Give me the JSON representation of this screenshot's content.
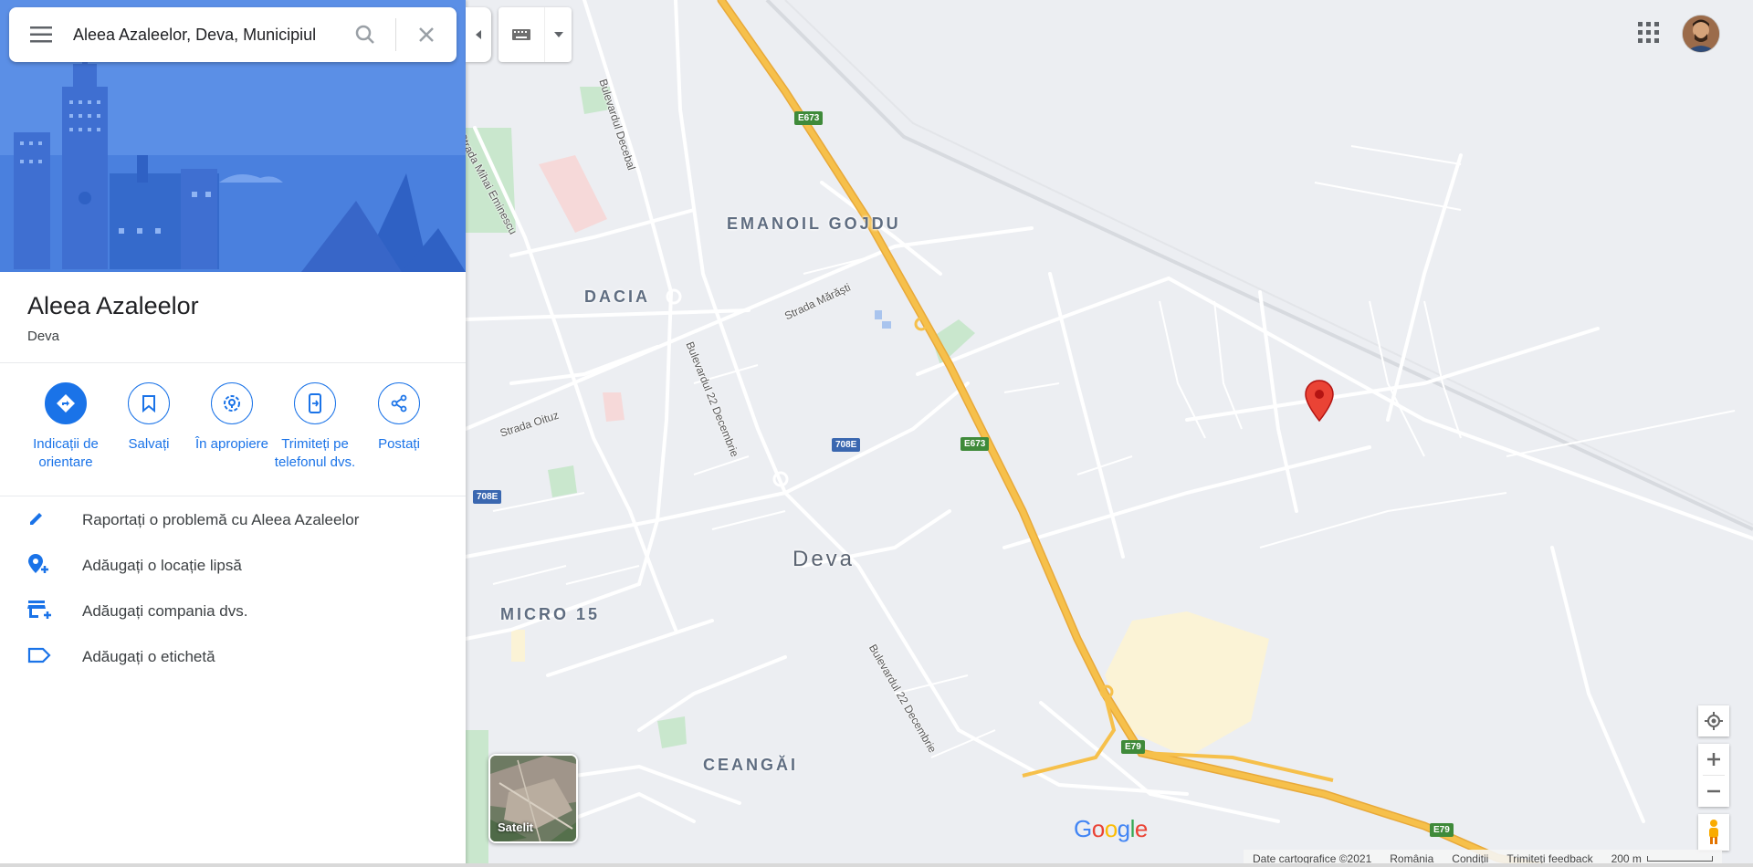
{
  "search": {
    "query": "Aleea Azaleelor, Deva, Municipiul"
  },
  "place": {
    "title": "Aleea Azaleelor",
    "subtitle": "Deva"
  },
  "actions": [
    {
      "label": "Indicații de orientare",
      "icon": "directions-icon"
    },
    {
      "label": "Salvați",
      "icon": "bookmark-icon"
    },
    {
      "label": "În apropiere",
      "icon": "nearby-icon"
    },
    {
      "label": "Trimiteți pe telefonul dvs.",
      "icon": "send-to-phone-icon"
    },
    {
      "label": "Postați",
      "icon": "share-icon"
    }
  ],
  "links": [
    {
      "label": "Raportați o problemă cu Aleea Azaleelor",
      "icon": "pencil-icon"
    },
    {
      "label": "Adăugați o locație lipsă",
      "icon": "add-location-icon"
    },
    {
      "label": "Adăugați compania dvs.",
      "icon": "add-business-icon"
    },
    {
      "label": "Adăugați o etichetă",
      "icon": "label-icon"
    }
  ],
  "map": {
    "neighborhoods": [
      "EMANOIL GOJDU",
      "DACIA",
      "MICRO 15",
      "CEANGĂI"
    ],
    "city": "Deva",
    "streets": [
      "Bulevardul Decebal",
      "Strada Mihai Eminescu",
      "Strada Mărăști",
      "Bulevardul 22 Decembrie",
      "Strada Oituz",
      "Bulevardul 22 Decembrie"
    ],
    "shields": [
      "E673",
      "E673",
      "708E",
      "708E",
      "E79",
      "E79"
    ]
  },
  "satellite_label": "Satelit",
  "google_logo": "Google",
  "footer": {
    "data": "Date cartografice ©2021",
    "country": "România",
    "terms": "Condiții",
    "feedback": "Trimiteți feedback",
    "scale": "200 m"
  },
  "colors": {
    "accent": "#1a73e8",
    "highway": "#f6c04b",
    "marker": "#ea4335"
  }
}
